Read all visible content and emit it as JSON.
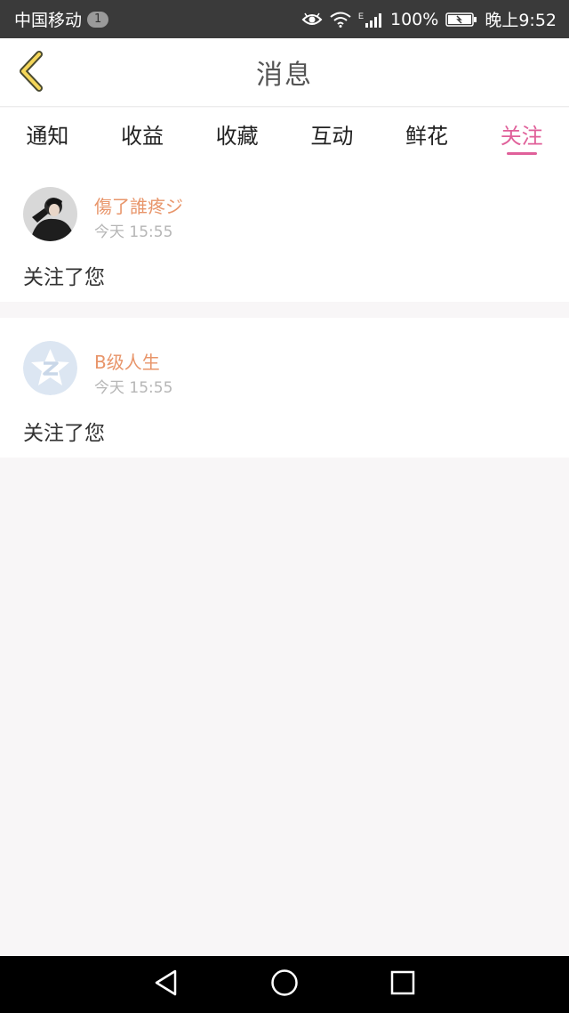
{
  "status_bar": {
    "carrier": "中国移动",
    "notification_count": "1",
    "network_type": "E",
    "battery": "100%",
    "time": "晚上9:52"
  },
  "header": {
    "title": "消息",
    "back_icon": "chevron-left-icon"
  },
  "tabs": [
    {
      "label": "通知",
      "active": false
    },
    {
      "label": "收益",
      "active": false
    },
    {
      "label": "收藏",
      "active": false
    },
    {
      "label": "互动",
      "active": false
    },
    {
      "label": "鲜花",
      "active": false
    },
    {
      "label": "关注",
      "active": true
    }
  ],
  "messages": [
    {
      "username": "傷了誰疼ジ",
      "time": "今天 15:55",
      "text": "关注了您",
      "avatar": "photo"
    },
    {
      "username": "B级人生",
      "time": "今天 15:55",
      "text": "关注了您",
      "avatar": "qzone-star-icon"
    }
  ],
  "colors": {
    "accent": "#e0609a",
    "username": "#e8956a",
    "timestamp": "#b6b6b6",
    "background": "#f8f6f7"
  },
  "nav_bar": {
    "icons": [
      "back-triangle-icon",
      "home-circle-icon",
      "recents-square-icon"
    ]
  }
}
